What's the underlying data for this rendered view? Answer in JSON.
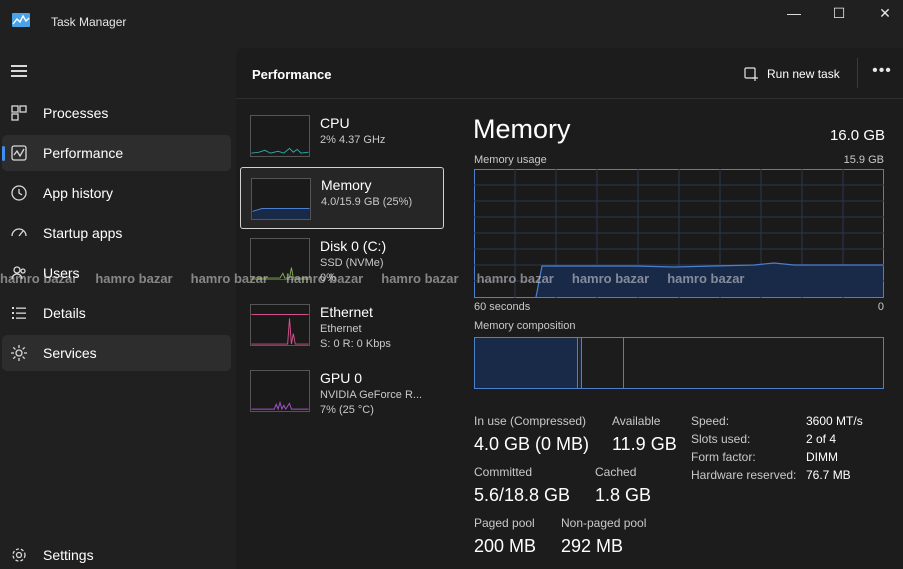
{
  "window": {
    "title": "Task Manager",
    "minimize": "—",
    "maximize": "☐",
    "close": "✕"
  },
  "sidebar": {
    "items": [
      {
        "label": "Processes",
        "icon": "processes-icon"
      },
      {
        "label": "Performance",
        "icon": "performance-icon"
      },
      {
        "label": "App history",
        "icon": "app-history-icon"
      },
      {
        "label": "Startup apps",
        "icon": "startup-apps-icon"
      },
      {
        "label": "Users",
        "icon": "users-icon"
      },
      {
        "label": "Details",
        "icon": "details-icon"
      },
      {
        "label": "Services",
        "icon": "services-icon"
      }
    ],
    "settings": "Settings",
    "active_index": 1
  },
  "header": {
    "title": "Performance",
    "run_new_task": "Run new task",
    "more": "•••"
  },
  "devices": [
    {
      "name": "CPU",
      "sub1": "2% 4.37 GHz",
      "sub2": ""
    },
    {
      "name": "Memory",
      "sub1": "4.0/15.9 GB (25%)",
      "sub2": ""
    },
    {
      "name": "Disk 0 (C:)",
      "sub1": "SSD (NVMe)",
      "sub2": "0%"
    },
    {
      "name": "Ethernet",
      "sub1": "Ethernet",
      "sub2": "S: 0 R: 0 Kbps"
    },
    {
      "name": "GPU 0",
      "sub1": "NVIDIA GeForce R...",
      "sub2": "7% (25 °C)"
    }
  ],
  "detail": {
    "title": "Memory",
    "total": "16.0 GB",
    "usage_label": "Memory usage",
    "usage_max": "15.9 GB",
    "time_left": "60 seconds",
    "time_right": "0",
    "composition_label": "Memory composition",
    "in_use_label": "In use (Compressed)",
    "in_use_value": "4.0 GB (0 MB)",
    "available_label": "Available",
    "available_value": "11.9 GB",
    "committed_label": "Committed",
    "committed_value": "5.6/18.8 GB",
    "cached_label": "Cached",
    "cached_value": "1.8 GB",
    "paged_label": "Paged pool",
    "paged_value": "200 MB",
    "nonpaged_label": "Non-paged pool",
    "nonpaged_value": "292 MB",
    "specs": [
      {
        "label": "Speed:",
        "value": "3600 MT/s"
      },
      {
        "label": "Slots used:",
        "value": "2 of 4"
      },
      {
        "label": "Form factor:",
        "value": "DIMM"
      },
      {
        "label": "Hardware reserved:",
        "value": "76.7 MB"
      }
    ]
  },
  "watermark": "hamro bazar",
  "colors": {
    "accent": "#3f8ef0",
    "memory_line": "#4d7fcf",
    "memory_fill": "#192a48",
    "cpu_line": "#2aa8a8",
    "disk_line": "#7fb04a",
    "ethernet_line": "#d4508a",
    "gpu_line": "#a453c9"
  }
}
